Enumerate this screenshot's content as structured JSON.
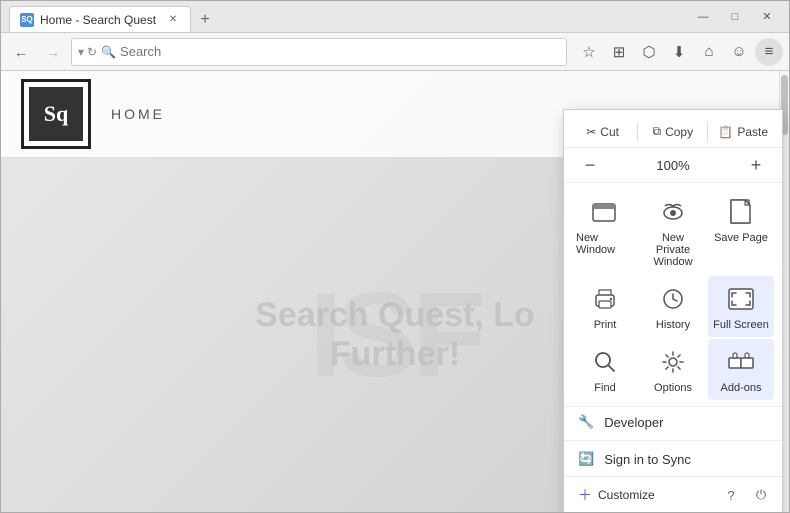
{
  "window": {
    "title": "Home - Search Quest",
    "controls": {
      "minimize": "—",
      "maximize": "□",
      "close": "✕"
    }
  },
  "tab": {
    "favicon": "SQ",
    "label": "Home - Search Quest",
    "close": "✕"
  },
  "new_tab_btn": "+",
  "nav": {
    "back": "←",
    "forward": "→",
    "refresh": "↻",
    "search_placeholder": "Search",
    "url": "",
    "bookmark_icon": "☆",
    "reading_icon": "⊞",
    "pocket_icon": "⬡",
    "download_icon": "⬇",
    "home_icon": "⌂",
    "smiley_icon": "☺",
    "menu_icon": "≡"
  },
  "page": {
    "logo_text": "Sq",
    "home_label": "HOME",
    "tagline_line1": "Search Quest, Lo",
    "tagline_line2": "Further!",
    "watermark": "ISF"
  },
  "menu": {
    "cut_label": "Cut",
    "copy_label": "Copy",
    "paste_label": "Paste",
    "zoom_minus": "−",
    "zoom_value": "100%",
    "zoom_plus": "+",
    "items": [
      {
        "id": "new-window",
        "icon": "▭",
        "label": "New Window"
      },
      {
        "id": "new-private",
        "icon": "🕶",
        "label": "New Private Window"
      },
      {
        "id": "save-page",
        "icon": "💾",
        "label": "Save Page"
      },
      {
        "id": "print",
        "icon": "🖨",
        "label": "Print"
      },
      {
        "id": "history",
        "icon": "🕐",
        "label": "History"
      },
      {
        "id": "full-screen",
        "icon": "⛶",
        "label": "Full Screen"
      },
      {
        "id": "find",
        "icon": "🔍",
        "label": "Find"
      },
      {
        "id": "options",
        "icon": "⚙",
        "label": "Options"
      },
      {
        "id": "add-ons",
        "icon": "🧩",
        "label": "Add-ons"
      }
    ],
    "developer_label": "Developer",
    "developer_icon": "🔧",
    "sign_in_label": "Sign in to Sync",
    "sign_in_icon": "🔄",
    "customize_label": "Customize",
    "customize_icon": "＋",
    "help_icon": "?",
    "power_icon": "⏻"
  }
}
